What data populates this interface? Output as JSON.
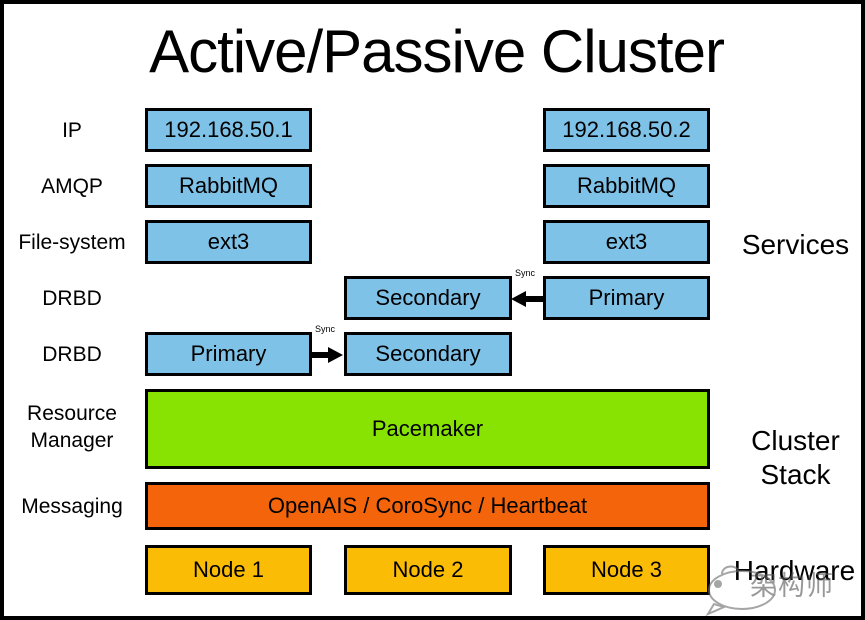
{
  "diagram": {
    "title": "Active/Passive Cluster",
    "background": "#ffffff",
    "border_color": "#000000"
  },
  "colors": {
    "service_blue": "#7FC2E8",
    "pacemaker_green": "#88E303",
    "messaging_orange": "#F4650B",
    "node_yellow": "#FBBC05",
    "outline": "#000000",
    "text": "#000000"
  },
  "row_labels": [
    {
      "id": "ip",
      "text": "IP"
    },
    {
      "id": "amqp",
      "text": "AMQP"
    },
    {
      "id": "file-system",
      "text": "File-system"
    },
    {
      "id": "drbd-upper",
      "text": "DRBD"
    },
    {
      "id": "drbd-lower",
      "text": "DRBD"
    },
    {
      "id": "resource-manager",
      "line1": "Resource",
      "line2": "Manager"
    },
    {
      "id": "messaging",
      "text": "Messaging"
    }
  ],
  "side_labels": [
    {
      "id": "services",
      "text": "Services"
    },
    {
      "id": "cluster-stack",
      "line1": "Cluster",
      "line2": "Stack"
    },
    {
      "id": "hardware",
      "text": "Hardware"
    }
  ],
  "nodes": {
    "ip_left": "192.168.50.1",
    "ip_right": "192.168.50.2",
    "amqp_left": "RabbitMQ",
    "amqp_right": "RabbitMQ",
    "fs_left": "ext3",
    "fs_right": "ext3",
    "drbd_upper_middle": "Secondary",
    "drbd_upper_right": "Primary",
    "drbd_lower_left": "Primary",
    "drbd_lower_middle": "Secondary",
    "pacemaker": "Pacemaker",
    "messaging": "OpenAIS / CoroSync / Heartbeat",
    "node1": "Node 1",
    "node2": "Node 2",
    "node3": "Node 3"
  },
  "arrows": {
    "upper_sync_label": "Sync",
    "upper_direction": "left",
    "lower_sync_label": "Sync",
    "lower_direction": "right"
  },
  "watermark": {
    "text_cn": "架构师"
  }
}
